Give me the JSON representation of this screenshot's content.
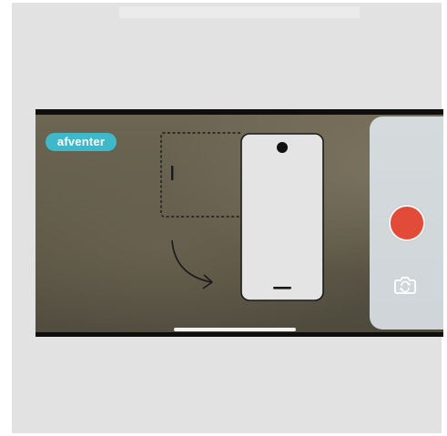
{
  "status_badge": {
    "label": "afventer",
    "color": "#3fb8c9"
  },
  "illustration": {
    "description_icons": [
      "rotate-phone-icon",
      "curved-arrow-icon"
    ]
  },
  "controls": {
    "record_button": {
      "icon": "record-icon",
      "color": "#e24b37"
    },
    "switch_camera": {
      "icon": "camera-switch-icon"
    }
  },
  "colors": {
    "panel": "#d5dadd",
    "accent": "#3fb8c9",
    "record": "#e24b37"
  }
}
